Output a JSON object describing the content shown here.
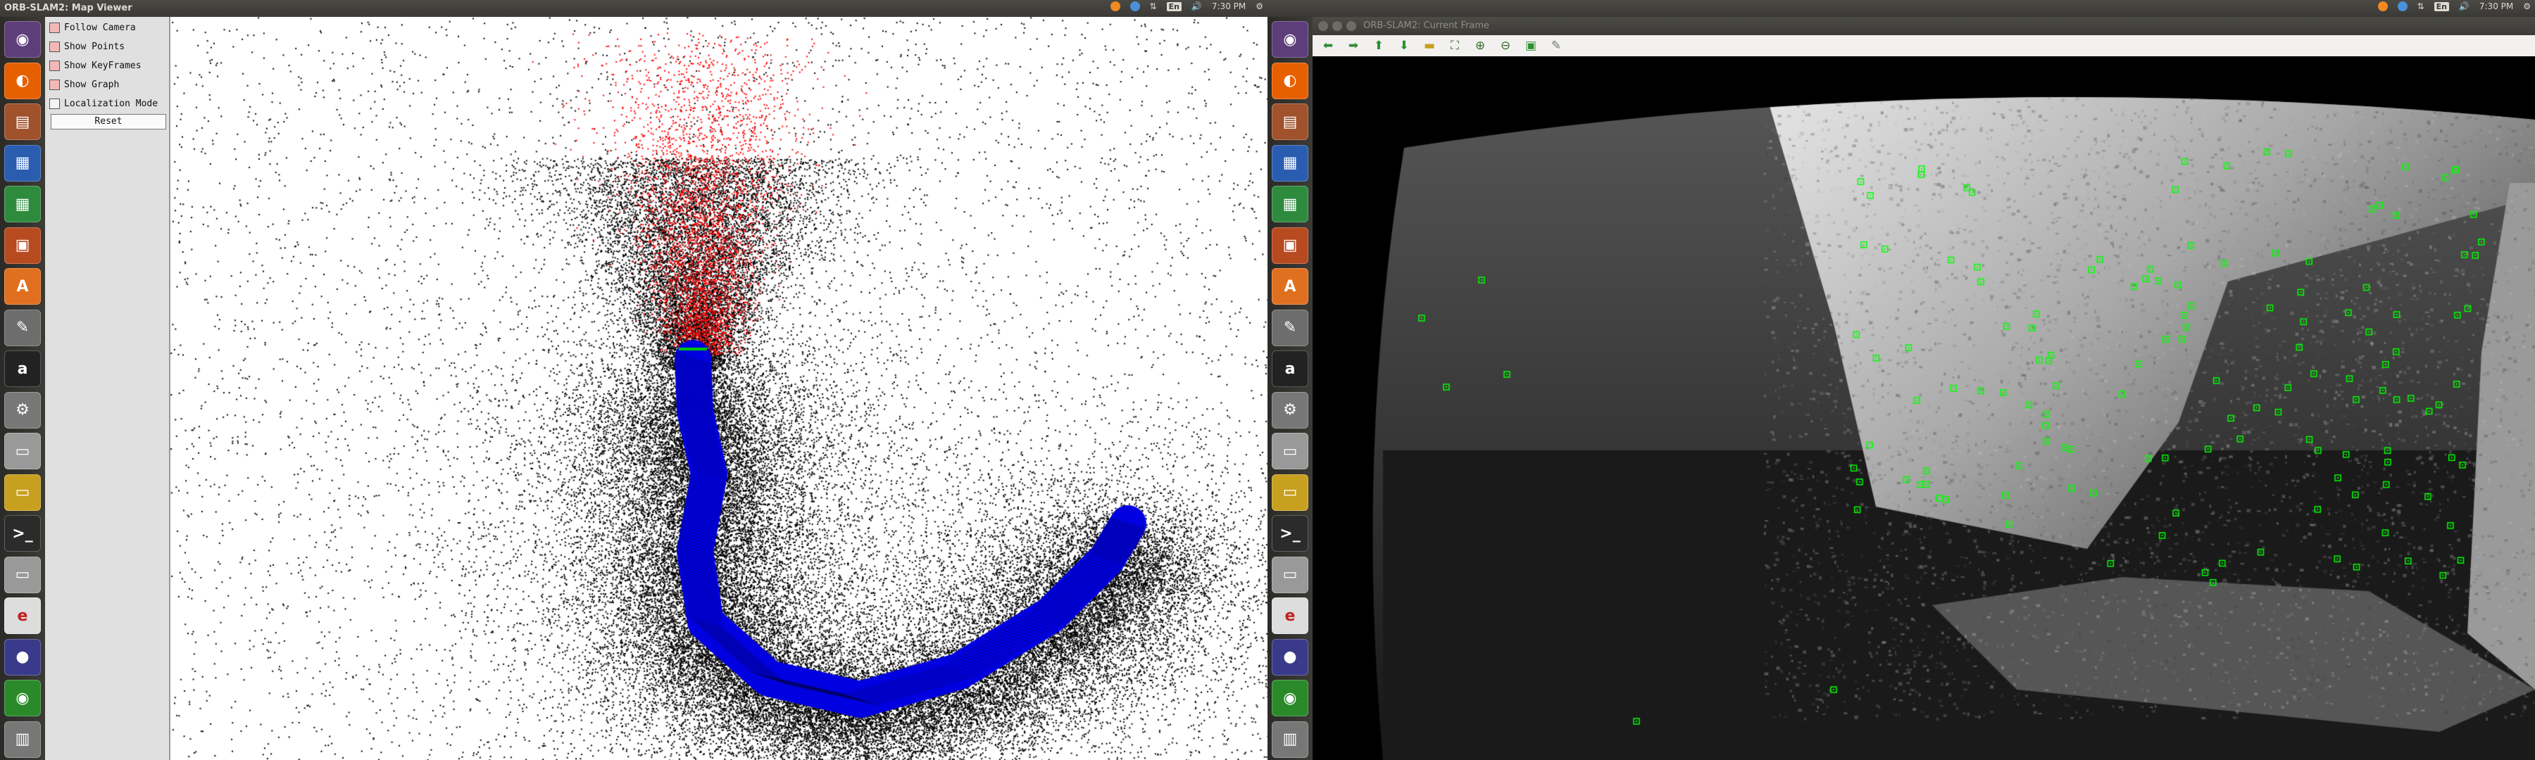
{
  "left": {
    "window_title": "ORB-SLAM2: Map Viewer",
    "clock": "7:30 PM",
    "keyboard": "En",
    "panel": {
      "options": [
        {
          "label": "Follow Camera",
          "checked": true
        },
        {
          "label": "Show Points",
          "checked": true
        },
        {
          "label": "Show KeyFrames",
          "checked": true
        },
        {
          "label": "Show Graph",
          "checked": true
        },
        {
          "label": "Localization Mode",
          "checked": false
        }
      ],
      "reset_label": "Reset"
    }
  },
  "right": {
    "window_title": "ORB-SLAM2: Current Frame",
    "clock": "7:30 PM",
    "keyboard": "En",
    "toolbar": [
      "back-arrow-icon",
      "forward-arrow-icon",
      "up-arrow-icon",
      "down-arrow-icon",
      "folder-icon",
      "fit-window-icon",
      "zoom-in-icon",
      "zoom-out-icon",
      "save-icon",
      "edit-icon"
    ]
  },
  "launcher_icons": [
    "dash-icon",
    "firefox-icon",
    "files-icon",
    "writer-icon",
    "calc-icon",
    "impress-icon",
    "software-center-icon",
    "text-editor-icon",
    "amazon-icon",
    "system-settings-icon",
    "drive-icon",
    "monitor-icon",
    "terminal-icon",
    "drive-icon",
    "xfig-icon",
    "eclipse-icon",
    "browser-icon",
    "trash-icon"
  ],
  "colors": {
    "map_points": "#000000",
    "reference_points": "#ff0000",
    "keyframes": "#0000ff",
    "features": "#00ff00"
  }
}
